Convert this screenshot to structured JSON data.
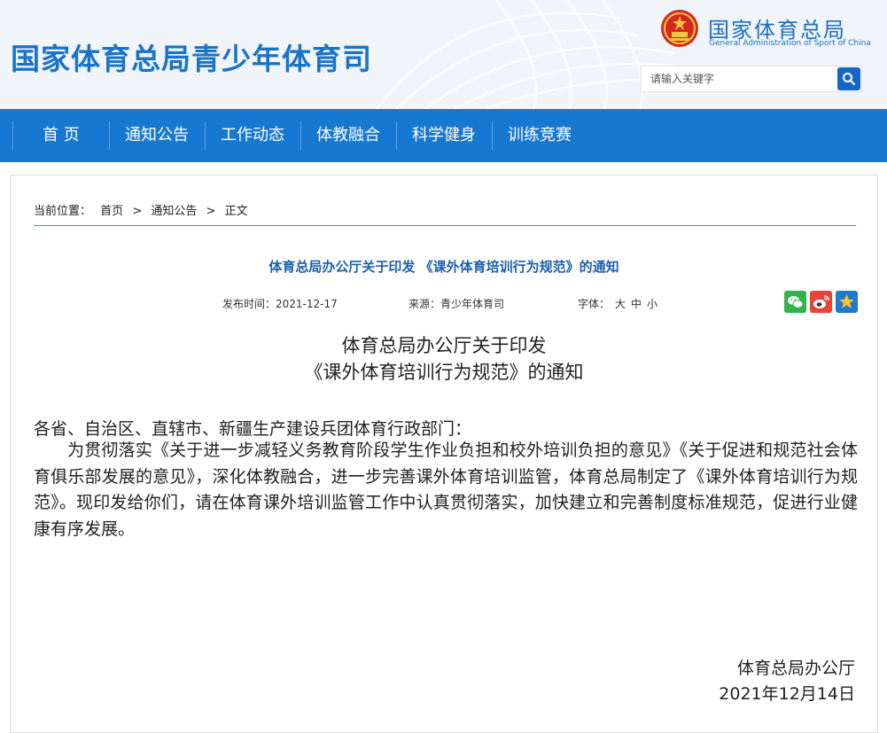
{
  "site": {
    "title": "国家体育总局青少年体育司",
    "brand_cn": "国家体育总局",
    "brand_en": "General Administration of Sport of China"
  },
  "search": {
    "placeholder": "请输入关键字"
  },
  "nav": [
    "首 页",
    "通知公告",
    "工作动态",
    "体教融合",
    "科学健身",
    "训练竞赛"
  ],
  "breadcrumb": {
    "label": "当前位置：",
    "home": "首页",
    "sep": ">",
    "section": "通知公告",
    "current": "正文"
  },
  "article": {
    "title": "体育总局办公厅关于印发 《课外体育培训行为规范》的通知",
    "meta": {
      "date": "发布时间：2021-12-17",
      "source": "来源：青少年体育司",
      "font_label": "字体：",
      "font_large": "大",
      "font_medium": "中",
      "font_small": "小"
    },
    "heading_line1": "体育总局办公厅关于印发",
    "heading_line2": "《课外体育培训行为规范》的通知",
    "salutation": "各省、自治区、直辖市、新疆生产建设兵团体育行政部门：",
    "body": "为贯彻落实《关于进一步减轻义务教育阶段学生作业负担和校外培训负担的意见》《关于促进和规范社会体育俱乐部发展的意见》，深化体教融合，进一步完善课外体育培训监管，体育总局制定了《课外体育培训行为规范》。现印发给你们，请在体育课外培训监管工作中认真贯彻落实，加快建立和完善制度标准规范，促进行业健康有序发展。",
    "signature": "体育总局办公厅",
    "sign_date": "2021年12月14日"
  },
  "share_icons": [
    "wechat-icon",
    "weibo-icon",
    "favorite-star-icon"
  ],
  "colors": {
    "brand_blue": "#1778d2",
    "title_blue": "#1d5fae",
    "header_bg": "#f1f5fa"
  }
}
